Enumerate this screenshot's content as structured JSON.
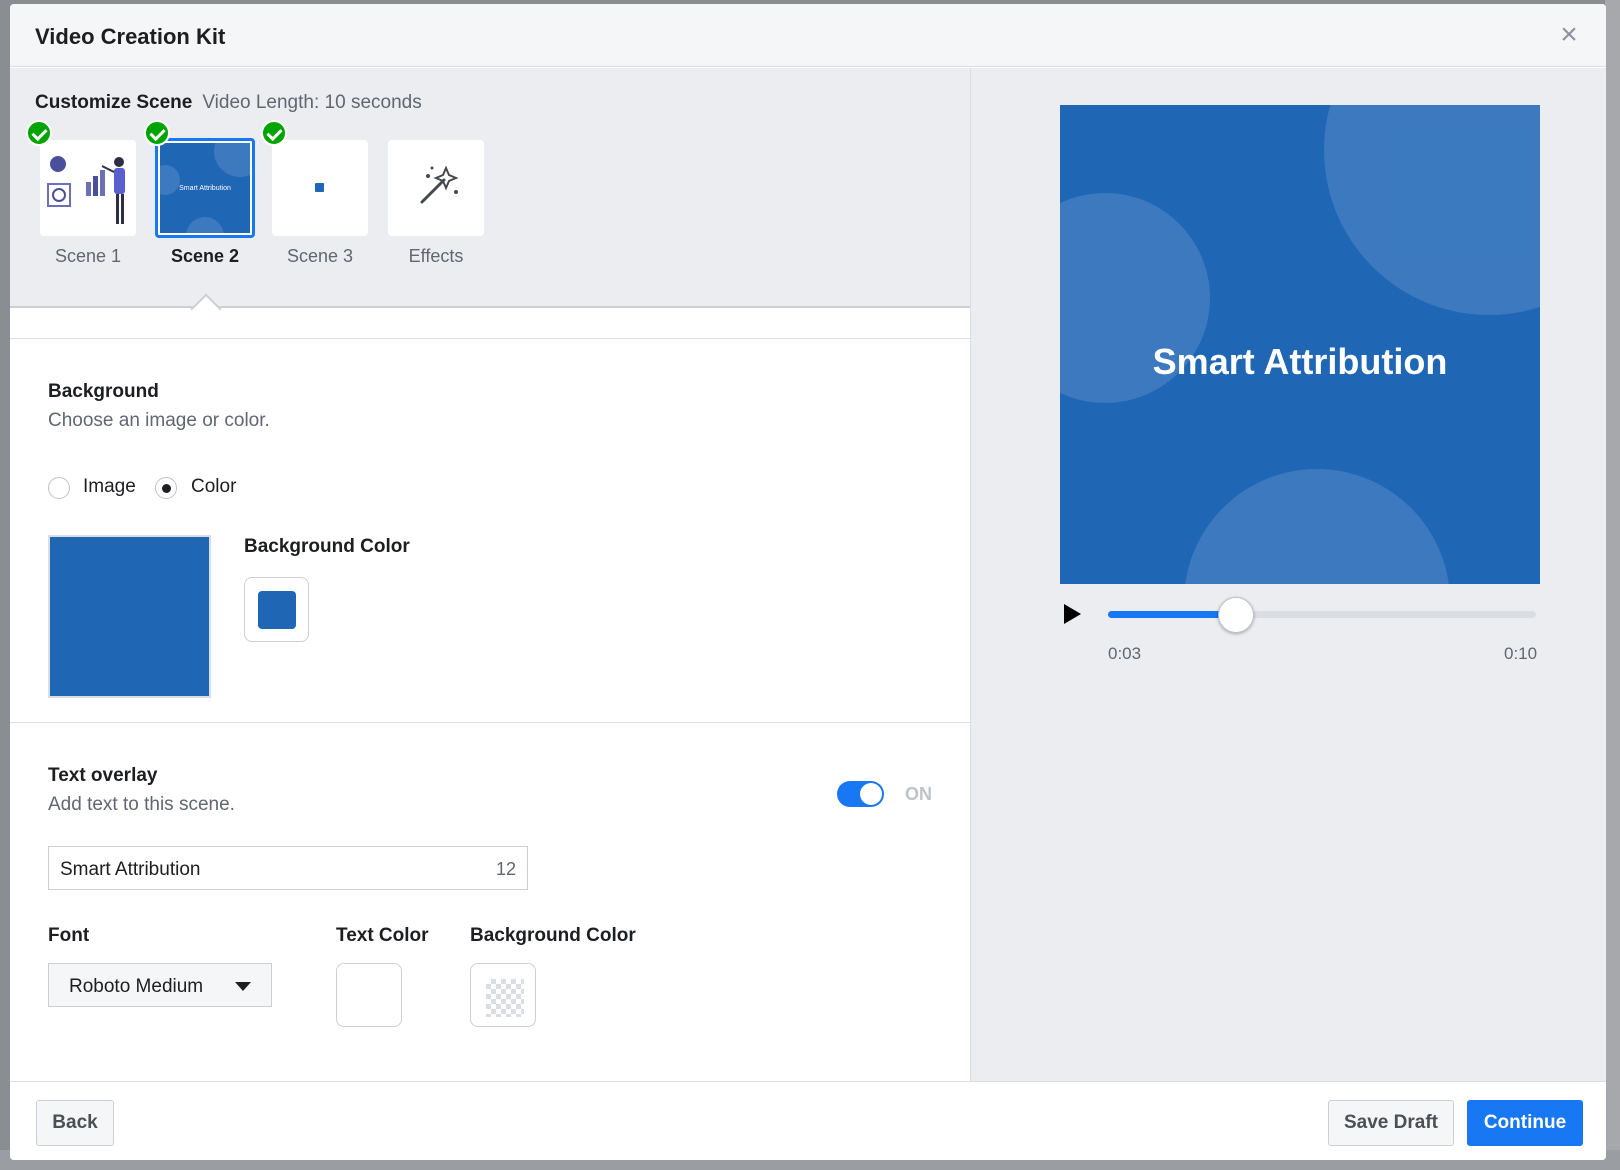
{
  "modal": {
    "title": "Video Creation Kit",
    "close_label": "×"
  },
  "scene_bar": {
    "title": "Customize Scene",
    "video_length": "Video Length: 10 seconds",
    "items": [
      {
        "label": "Scene 1",
        "completed": true,
        "selected": false
      },
      {
        "label": "Scene 2",
        "completed": true,
        "selected": true,
        "thumb_text": "Smart Attribution"
      },
      {
        "label": "Scene 3",
        "completed": true,
        "selected": false
      },
      {
        "label": "Effects",
        "completed": false,
        "selected": false,
        "icon": "magic-wand-icon"
      }
    ]
  },
  "background": {
    "title": "Background",
    "description": "Choose an image or color.",
    "options": [
      "Image",
      "Color"
    ],
    "selected_option": "Color",
    "color_label": "Background Color",
    "color_value": "#1f66b5"
  },
  "text_overlay": {
    "title": "Text overlay",
    "description": "Add text to this scene.",
    "toggle_label": "ON",
    "text_value": "Smart Attribution",
    "char_count": "12",
    "font_label": "Font",
    "font_value": "Roboto Medium",
    "text_color_label": "Text Color",
    "text_color_value": "#ffffff",
    "bg_color_label": "Background Color",
    "bg_color_value": "transparent"
  },
  "preview": {
    "text": "Smart Attribution",
    "current_time": "0:03",
    "total_time": "0:10",
    "progress": 0.3
  },
  "footer": {
    "back_label": "Back",
    "save_draft_label": "Save Draft",
    "continue_label": "Continue"
  },
  "colors": {
    "accent": "#1877f2",
    "check": "#00a400",
    "scene_bg": "#1f66b5"
  }
}
